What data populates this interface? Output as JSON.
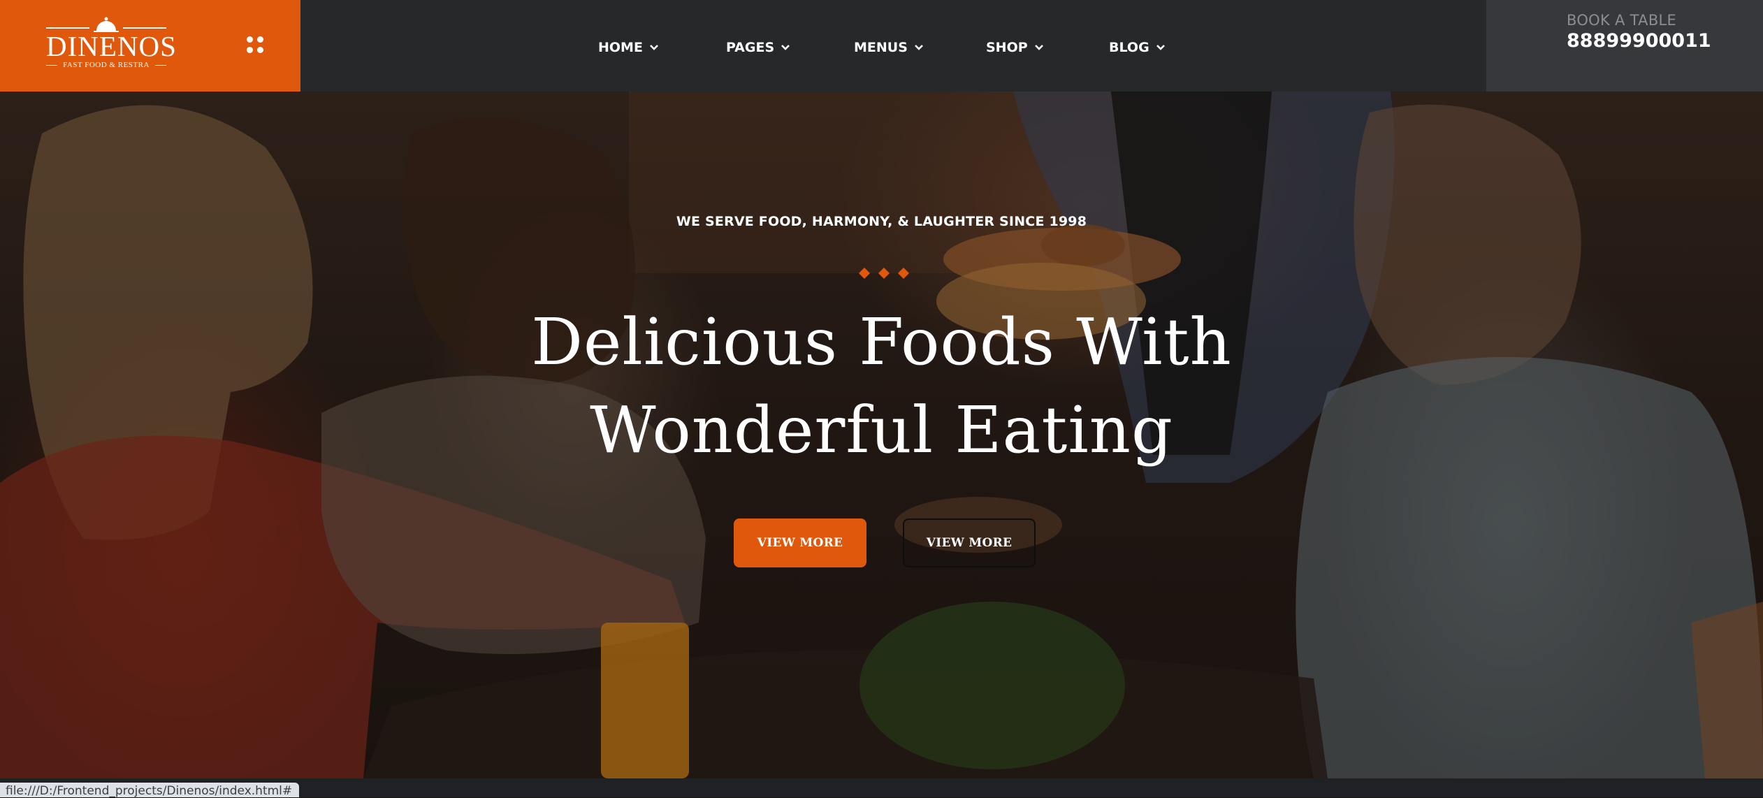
{
  "brand": {
    "name": "DINENOS",
    "tagline": "FAST FOOD & RESTRA",
    "colors": {
      "accent": "#e0580b",
      "header_bg": "#27282a",
      "book_bg": "#36383c"
    }
  },
  "header": {
    "menu_icon": "grid-dots-icon",
    "nav": [
      {
        "label": "HOME",
        "icon": "chevron-down-icon"
      },
      {
        "label": "PAGES",
        "icon": "chevron-down-icon"
      },
      {
        "label": "MENUS",
        "icon": "chevron-down-icon"
      },
      {
        "label": "SHOP",
        "icon": "chevron-down-icon"
      },
      {
        "label": "BLOG",
        "icon": "chevron-down-icon"
      }
    ],
    "booking": {
      "label": "BOOK A TABLE",
      "phone": "88899900011"
    }
  },
  "hero": {
    "kicker": "WE SERVE FOOD, HARMONY, & LAUGHTER SINCE 1998",
    "headline_line1": "Delicious Foods With",
    "headline_line2": "Wonderful Eating",
    "primary_button": "VIEW MORE",
    "secondary_button": "VIEW MORE",
    "divider_icon": "diamond-trio-icon"
  },
  "status_bar": {
    "url": "file:///D:/Frontend_projects/Dinenos/index.html#"
  }
}
